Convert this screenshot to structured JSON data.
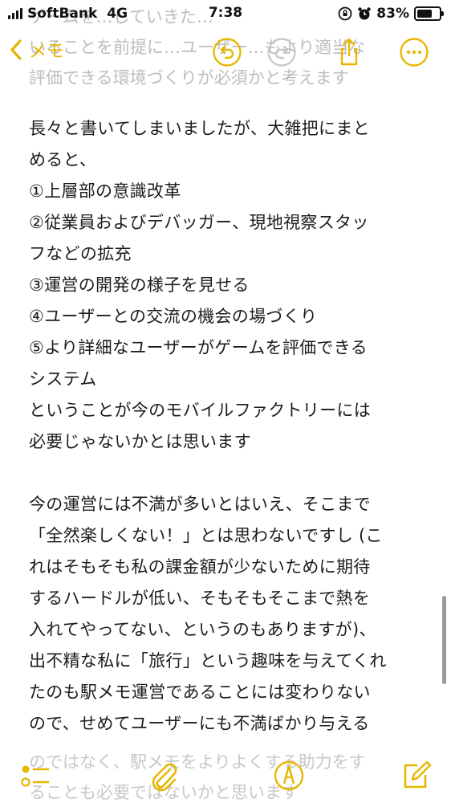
{
  "status_bar": {
    "carrier": "SoftBank",
    "network": "4G",
    "time": "7:38",
    "battery_percent": "83%",
    "battery_level": 0.83
  },
  "nav": {
    "back_label": "メモ",
    "icons": [
      "undo-icon",
      "redo-icon",
      "share-icon",
      "more-icon"
    ],
    "accent": "#e7b700"
  },
  "faded_top_lines": [
    "ゲームを…していきた…",
    "いることを前提に…ユーザー…もより適当な",
    "評価できる環境づくりが必須かと考えます"
  ],
  "note_lines": [
    "",
    "長々と書いてしまいましたが、大雑把にまと",
    "めると、",
    "①上層部の意識改革",
    "②従業員およびデバッガー、現地視察スタッ",
    "フなどの拡充",
    "③運営の開発の様子を見せる",
    "④ユーザーとの交流の機会の場づくり",
    "⑤より詳細なユーザーがゲームを評価できる",
    "システム",
    "ということが今のモバイルファクトリーには",
    "必要じゃないかとは思います",
    "",
    "今の運営には不満が多いとはいえ、そこまで",
    "「全然楽しくない！」とは思わないですし (こ",
    "れはそもそも私の課金額が少ないために期待",
    "するハードルが低い、そもそもそこまで熱を",
    "入れてやってない、というのもありますが)、",
    "出不精な私に「旅行」という趣味を与えてくれ",
    "たのも駅メモ運営であることには変わりない",
    "ので、せめてユーザーにも不満ばかり与える"
  ],
  "faded_bottom_lines": [
    "のではなく、駅メモをよりよくする助力をす",
    "ることも必要ではないかと思います"
  ],
  "toolbar": {
    "icons": [
      "checklist-icon",
      "paperclip-icon",
      "markup-icon",
      "compose-icon"
    ]
  }
}
